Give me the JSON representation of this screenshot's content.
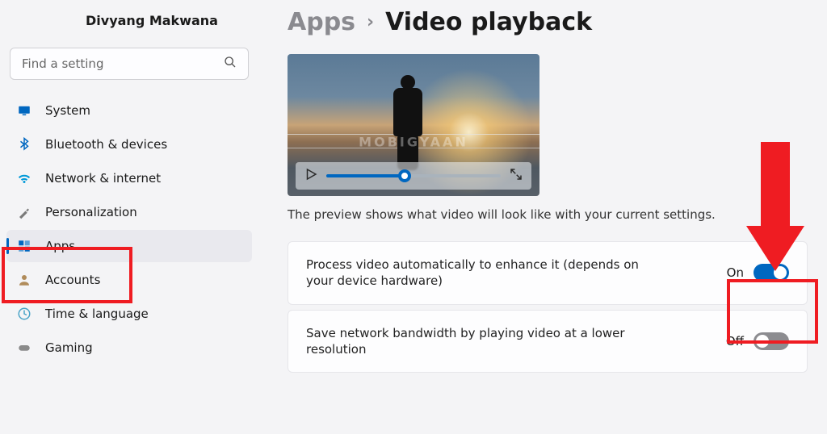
{
  "user": {
    "name": "Divyang Makwana"
  },
  "search": {
    "placeholder": "Find a setting"
  },
  "sidebar": {
    "items": [
      {
        "label": "System"
      },
      {
        "label": "Bluetooth & devices"
      },
      {
        "label": "Network & internet"
      },
      {
        "label": "Personalization"
      },
      {
        "label": "Apps"
      },
      {
        "label": "Accounts"
      },
      {
        "label": "Time & language"
      },
      {
        "label": "Gaming"
      }
    ]
  },
  "breadcrumb": {
    "parent": "Apps",
    "current": "Video playback"
  },
  "preview": {
    "watermark": "MOBIGYAAN",
    "caption": "The preview shows what video will look like with your current settings."
  },
  "settings": {
    "enhance": {
      "label": "Process video automatically to enhance it (depends on your device hardware)",
      "state_text": "On",
      "on": true
    },
    "bandwidth": {
      "label": "Save network bandwidth by playing video at a lower resolution",
      "state_text": "Off",
      "on": false
    }
  }
}
